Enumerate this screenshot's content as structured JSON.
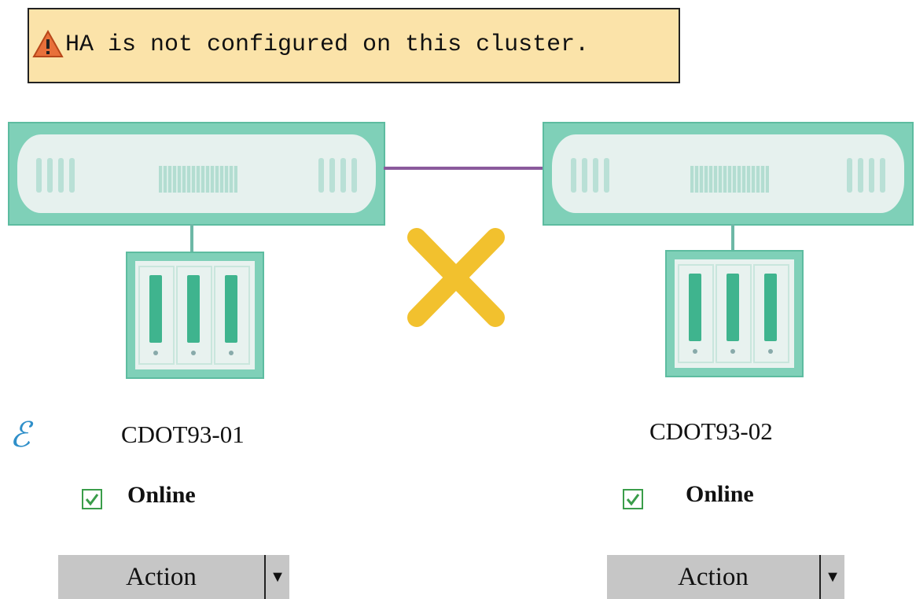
{
  "warning": {
    "text": "HA is not configured on this cluster.",
    "icon": "warning-triangle-icon"
  },
  "status_icons": {
    "ha_link": "x-mark-icon",
    "node_indicator": "epsilon-icon"
  },
  "nodes": [
    {
      "name": "CDOT93-01",
      "status": "Online",
      "action_label": "Action",
      "action_caret": "▼"
    },
    {
      "name": "CDOT93-02",
      "status": "Online",
      "action_label": "Action",
      "action_caret": "▼"
    }
  ],
  "colors": {
    "warning_bg": "#fbe3a9",
    "hardware": "#7fd0b8",
    "interconnect": "#8a5a9c",
    "x_mark": "#f2c12e",
    "online_check": "#3a9d4a",
    "button": "#c6c6c6",
    "epsilon": "#2f8fc9"
  }
}
